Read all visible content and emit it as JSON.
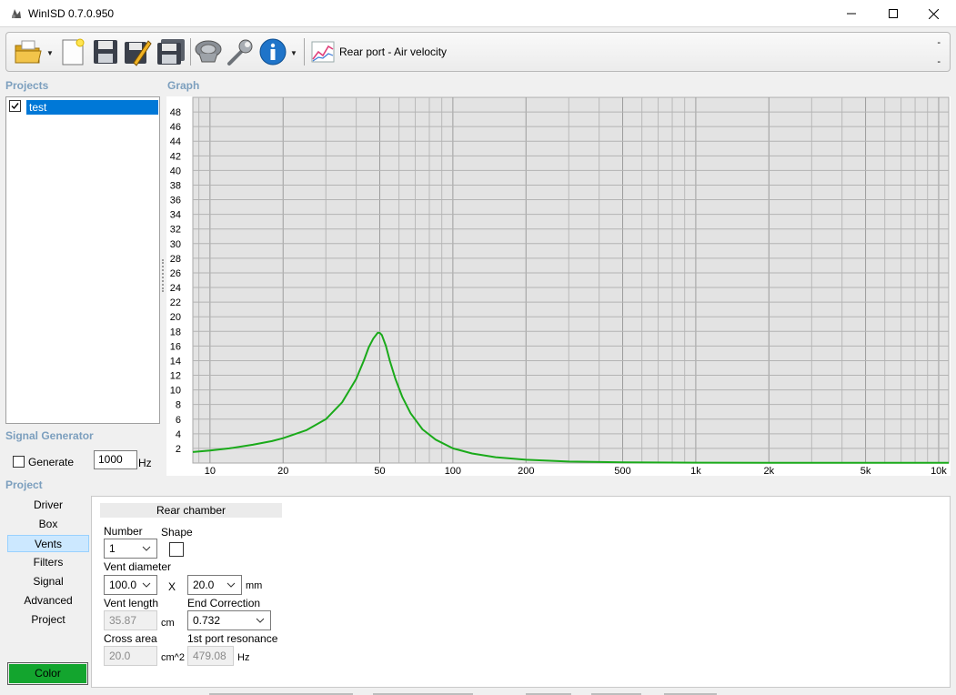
{
  "window": {
    "title": "WinISD 0.7.0.950"
  },
  "toolbar": {
    "graph_selector_label": "Rear port - Air velocity",
    "dash_top": "-",
    "dash_bottom": "-"
  },
  "projects": {
    "heading": "Projects",
    "items": [
      {
        "name": "test",
        "checked": true
      }
    ]
  },
  "graph": {
    "heading": "Graph"
  },
  "chart_data": {
    "type": "line",
    "xscale": "log",
    "xlim": [
      8.5,
      11000
    ],
    "ylim": [
      0,
      50
    ],
    "x_ticks": [
      10,
      20,
      50,
      100,
      200,
      500,
      1000,
      2000,
      5000,
      10000
    ],
    "x_tick_labels": [
      "10",
      "20",
      "50",
      "100",
      "200",
      "500",
      "1k",
      "2k",
      "5k",
      "10k"
    ],
    "y_ticks": [
      2,
      4,
      6,
      8,
      10,
      12,
      14,
      16,
      18,
      20,
      22,
      24,
      26,
      28,
      30,
      32,
      34,
      36,
      38,
      40,
      42,
      44,
      46,
      48
    ],
    "grid": true,
    "series": [
      {
        "color": "#1aaa1a",
        "x": [
          8.5,
          10,
          12,
          15,
          18,
          20,
          25,
          30,
          35,
          40,
          43,
          45,
          47,
          49,
          50,
          51,
          53,
          55,
          58,
          62,
          67,
          75,
          85,
          100,
          120,
          150,
          200,
          300,
          500,
          1000,
          2000,
          5000,
          10000,
          11000
        ],
        "y": [
          1.5,
          1.7,
          2.0,
          2.5,
          3.0,
          3.4,
          4.5,
          6.0,
          8.3,
          11.5,
          14.0,
          15.8,
          17.0,
          17.8,
          17.8,
          17.5,
          16.0,
          14.0,
          11.5,
          9.0,
          6.8,
          4.6,
          3.2,
          2.0,
          1.3,
          0.8,
          0.45,
          0.2,
          0.1,
          0.05,
          0.03,
          0.02,
          0.02,
          0.02
        ]
      }
    ]
  },
  "signal_generator": {
    "heading": "Signal Generator",
    "generate_label": "Generate",
    "frequency_value": "1000",
    "frequency_unit": "Hz"
  },
  "project_nav": {
    "heading": "Project",
    "items": [
      "Driver",
      "Box",
      "Vents",
      "Filters",
      "Signal",
      "Advanced",
      "Project"
    ],
    "active": "Vents",
    "color_button": "Color",
    "color_value": "#13a52e"
  },
  "vents_panel": {
    "chamber_tab": "Rear chamber",
    "number_label": "Number",
    "number_value": "1",
    "shape_label": "Shape",
    "vent_diameter_label": "Vent diameter",
    "vent_diameter_value": "100.0",
    "x_label": "X",
    "second_dim_value": "20.0",
    "mm_unit": "mm",
    "vent_length_label": "Vent length",
    "vent_length_value": "35.87",
    "cm_unit": "cm",
    "end_correction_label": "End Correction",
    "end_correction_value": "0.732",
    "cross_area_label": "Cross area",
    "cross_area_value": "20.0",
    "cm2_unit": "cm^2",
    "port_resonance_label": "1st port resonance",
    "port_resonance_value": "479.08",
    "hz_unit": "Hz"
  }
}
